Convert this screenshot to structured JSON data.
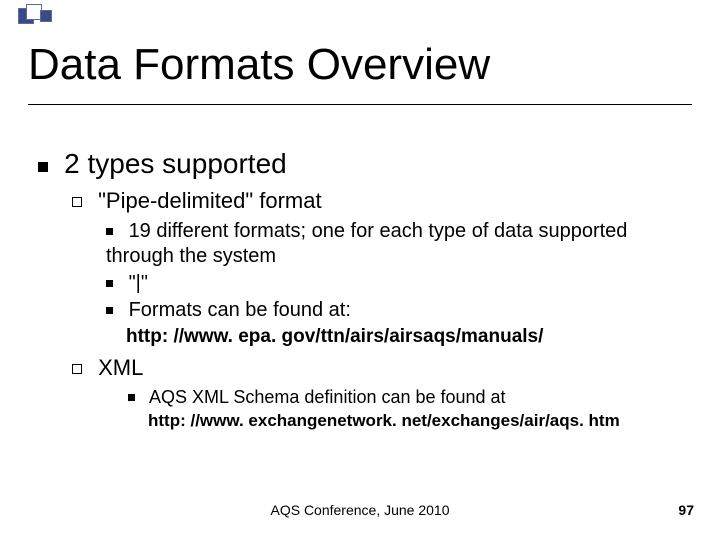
{
  "title": "Data Formats Overview",
  "main": {
    "heading": "2 types supported",
    "pipe": {
      "label": "\"Pipe-delimited\" format",
      "items": [
        "19 different formats; one for each type of data supported through the system",
        "\"|\"",
        "Formats can be found at:"
      ],
      "url": "http: //www. epa. gov/ttn/airs/airsaqs/manuals/"
    },
    "xml": {
      "label": "XML",
      "items": [
        "AQS XML Schema definition can be found at"
      ],
      "url": "http: //www. exchangenetwork. net/exchanges/air/aqs. htm"
    }
  },
  "footer": {
    "center": "AQS Conference, June 2010",
    "page": "97"
  }
}
